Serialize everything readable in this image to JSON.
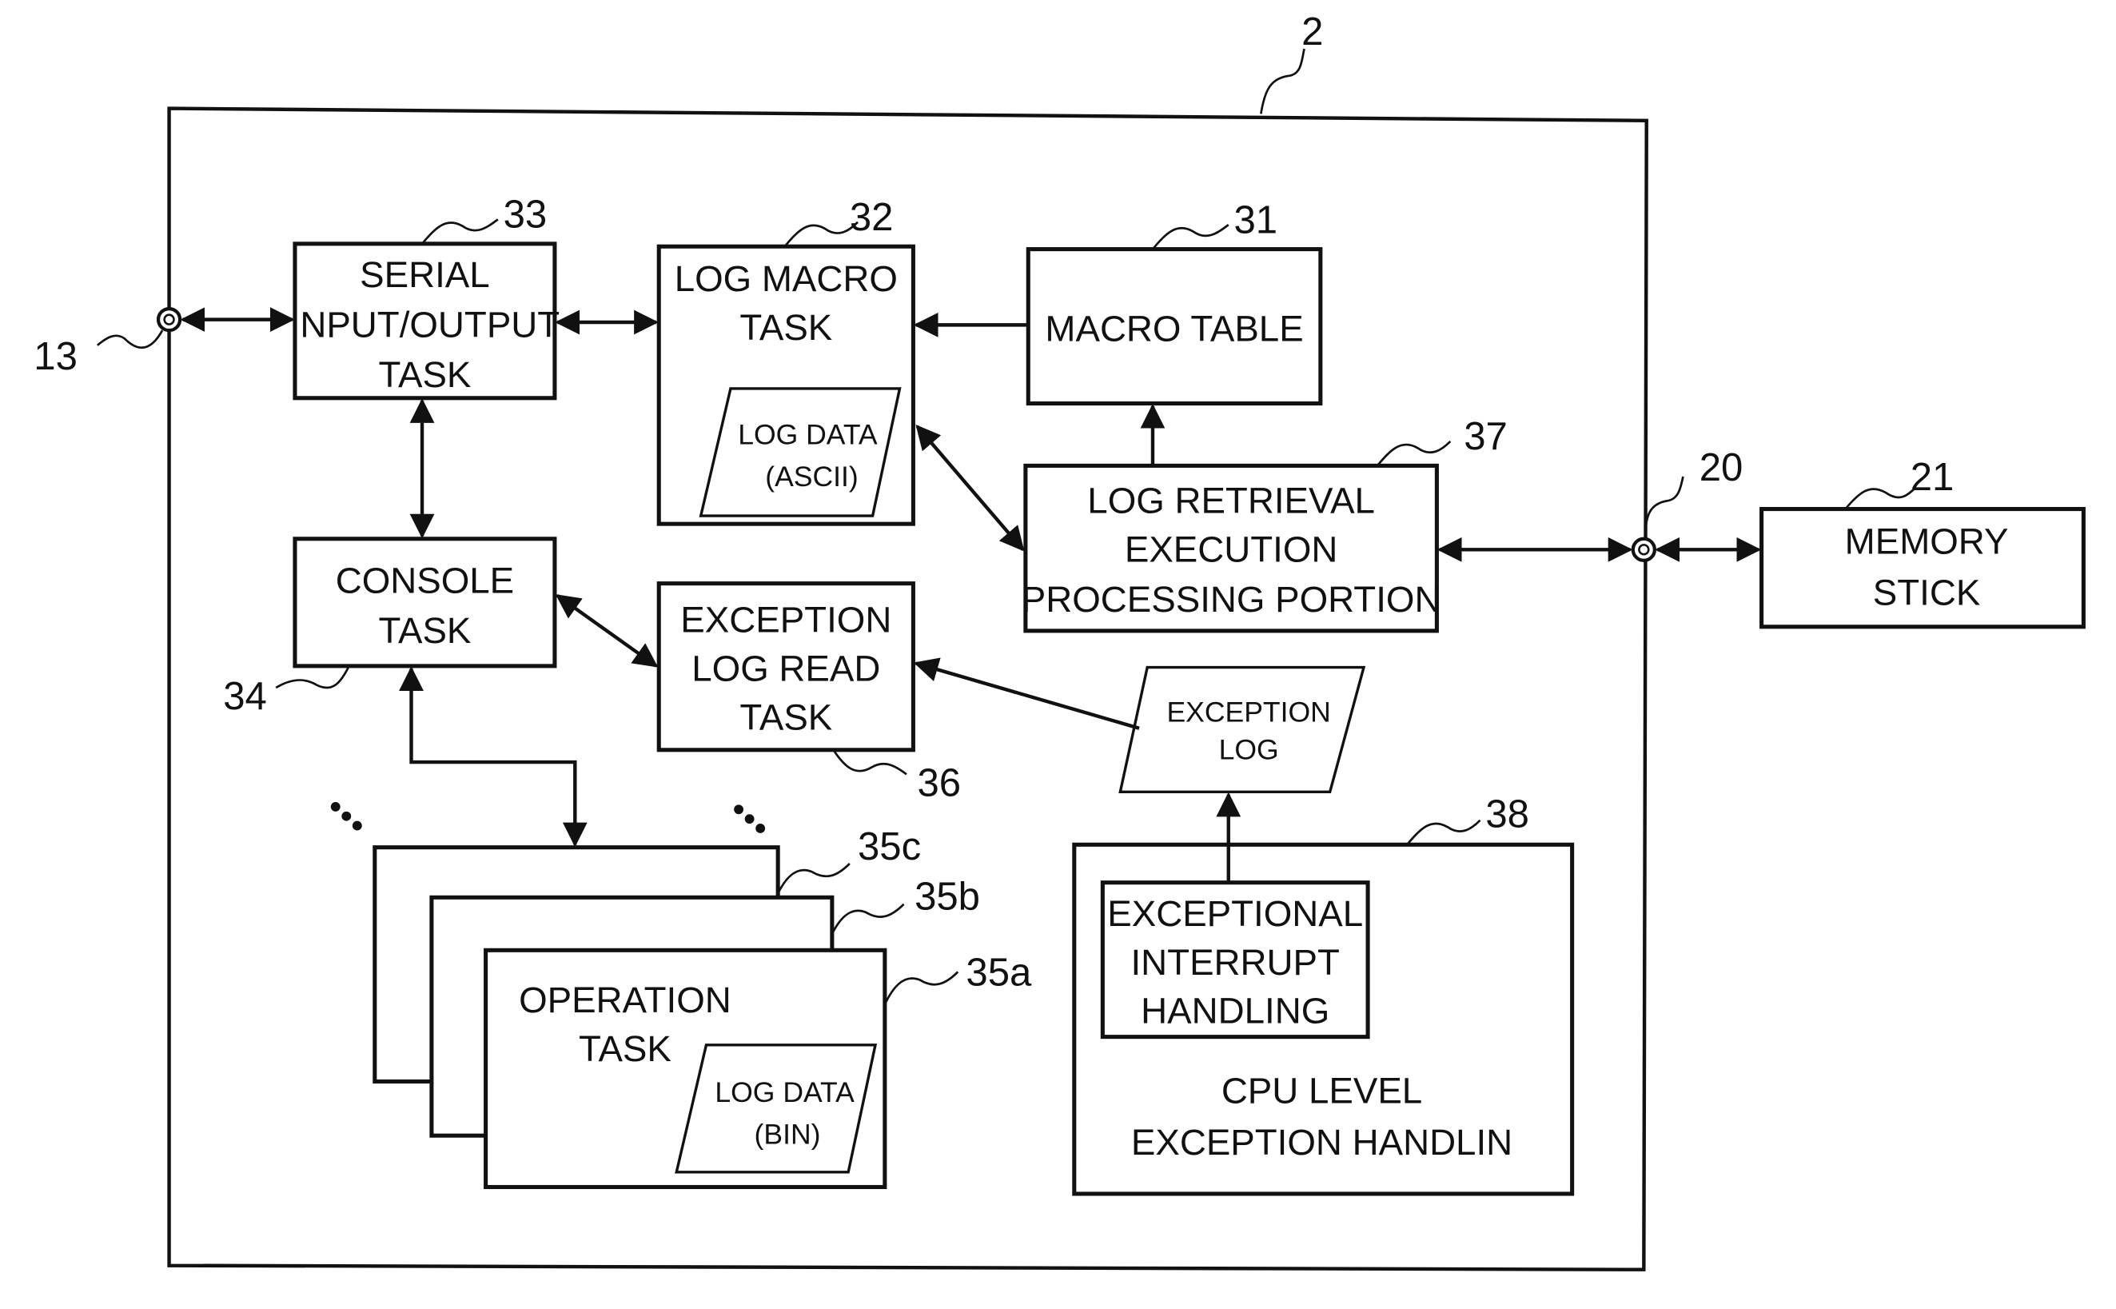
{
  "diagram": {
    "container_ref": "2",
    "ports": {
      "serial_port_ref": "13",
      "memory_port_ref": "20"
    },
    "blocks": {
      "serial_io_task": {
        "ref": "33",
        "lines": [
          "SERIAL",
          "INPUT/OUTPUT",
          "TASK"
        ]
      },
      "log_macro_task": {
        "ref": "32",
        "lines": [
          "LOG MACRO",
          "TASK"
        ]
      },
      "log_data_ascii": {
        "lines": [
          "LOG DATA",
          "(ASCII)"
        ]
      },
      "macro_table": {
        "ref": "31",
        "lines": [
          "MACRO TABLE"
        ]
      },
      "log_retrieval": {
        "ref": "37",
        "lines": [
          "LOG RETRIEVAL",
          "EXECUTION",
          "PROCESSING PORTION"
        ]
      },
      "memory_stick": {
        "ref": "21",
        "lines": [
          "MEMORY",
          "STICK"
        ]
      },
      "console_task": {
        "ref": "34",
        "lines": [
          "CONSOLE",
          "TASK"
        ]
      },
      "exception_log_read_task": {
        "ref": "36",
        "lines": [
          "EXCEPTION",
          "LOG READ",
          "TASK"
        ]
      },
      "exception_log": {
        "lines": [
          "EXCEPTION",
          "LOG"
        ]
      },
      "operation_task_c": {
        "ref": "35c"
      },
      "operation_task_b": {
        "ref": "35b"
      },
      "operation_task_a": {
        "ref": "35a",
        "lines": [
          "OPERATION",
          "TASK"
        ]
      },
      "log_data_bin": {
        "lines": [
          "LOG DATA",
          "(BIN)"
        ]
      },
      "cpu_exception": {
        "ref": "38",
        "lines": [
          "CPU LEVEL",
          "EXCEPTION HANDLIN"
        ]
      },
      "exceptional_interrupt": {
        "lines": [
          "EXCEPTIONAL",
          "INTERRUPT",
          "HANDLING"
        ]
      }
    },
    "connections": [
      {
        "from": "port-13",
        "to": "serial_io_task",
        "type": "bidirectional"
      },
      {
        "from": "serial_io_task",
        "to": "log_macro_task",
        "type": "bidirectional"
      },
      {
        "from": "macro_table",
        "to": "log_macro_task",
        "type": "directed"
      },
      {
        "from": "log_retrieval",
        "to": "macro_table",
        "type": "directed"
      },
      {
        "from": "log_macro_task",
        "to": "log_retrieval",
        "type": "bidirectional"
      },
      {
        "from": "log_retrieval",
        "to": "port-20",
        "type": "bidirectional"
      },
      {
        "from": "port-20",
        "to": "memory_stick",
        "type": "bidirectional"
      },
      {
        "from": "serial_io_task",
        "to": "console_task",
        "type": "bidirectional"
      },
      {
        "from": "console_task",
        "to": "exception_log_read_task",
        "type": "bidirectional"
      },
      {
        "from": "exception_log",
        "to": "exception_log_read_task",
        "type": "directed"
      },
      {
        "from": "exceptional_interrupt",
        "to": "exception_log",
        "type": "directed"
      },
      {
        "from": "console_task",
        "to": "operation_task_c",
        "type": "bidirectional"
      }
    ]
  }
}
